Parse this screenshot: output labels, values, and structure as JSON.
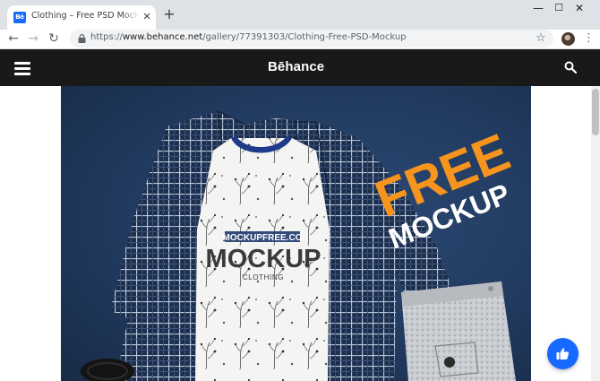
{
  "browser": {
    "tab": {
      "favicon_text": "Bē",
      "title": "Clothing – Free PSD Mockup on Behance",
      "close_glyph": "✕"
    },
    "new_tab_glyph": "+",
    "window_controls": {
      "minimize": "—",
      "maximize": "☐",
      "close": "✕"
    },
    "nav": {
      "back": "←",
      "forward": "→",
      "reload": "↻"
    },
    "omnibox": {
      "scheme": "https://",
      "host": "www.behance.net",
      "path": "/gallery/77391303/Clothing-Free-PSD-Mockup"
    },
    "bookmark_glyph": "☆",
    "menu_glyph": "⋮"
  },
  "site": {
    "logo": "Bēhance",
    "menu_icon": "hamburger-icon",
    "search_icon": "search-icon",
    "brand_color": "#1769ff",
    "header_color": "#191919"
  },
  "artwork": {
    "headline_top": "FREE",
    "headline_bottom": "MOCKUP",
    "brand_mark": "MOCKUPFREE.CO",
    "shirt_title": "MOCKUP",
    "shirt_subtitle": "CLOTHING",
    "accent_orange": "#f7941d"
  },
  "appreciate_button": {
    "icon": "thumbs-up-icon"
  }
}
